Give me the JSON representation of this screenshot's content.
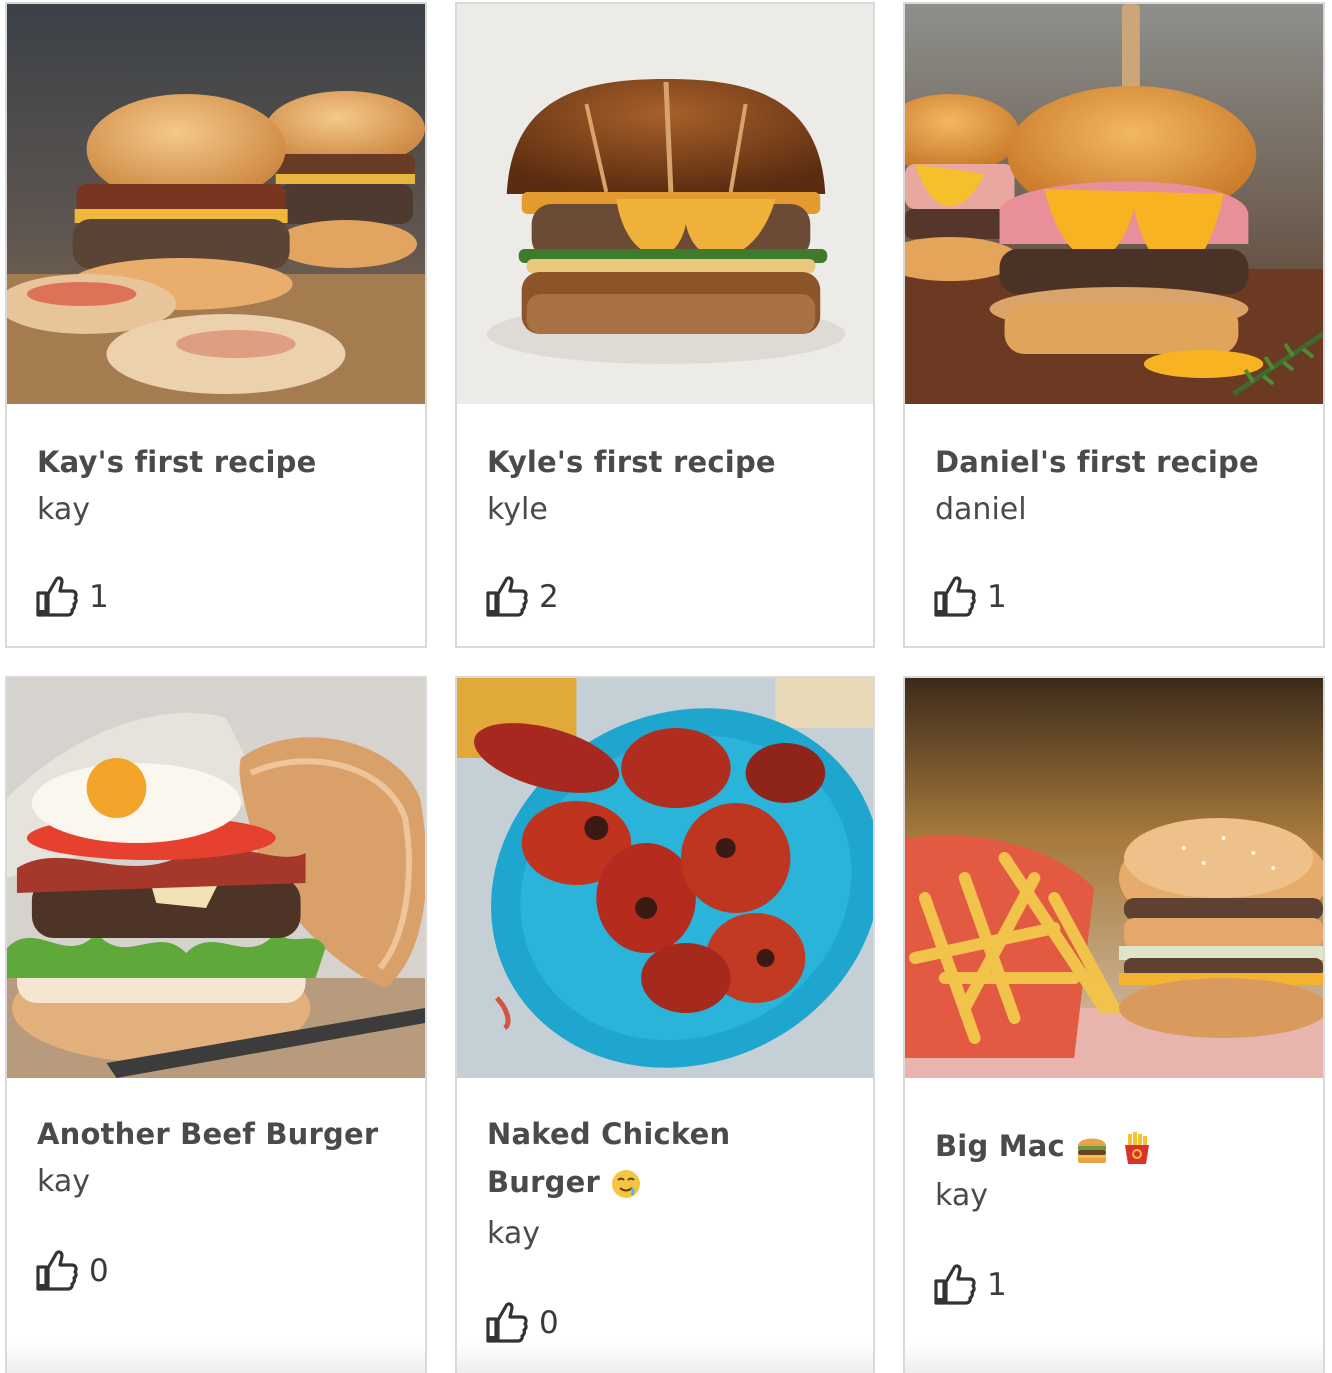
{
  "cards": [
    {
      "title": "Kay's first recipe",
      "author": "kay",
      "likes": "1",
      "image": "burger-sliders-photo"
    },
    {
      "title": "Kyle's first recipe",
      "author": "kyle",
      "likes": "2",
      "image": "pretzel-burger-photo"
    },
    {
      "title": "Daniel's first recipe",
      "author": "daniel",
      "likes": "1",
      "image": "ham-cheese-burger-photo"
    },
    {
      "title": "Another Beef Burger",
      "author": "kay",
      "likes": "0",
      "image": "egg-bacon-burger-photo"
    },
    {
      "title_line1": "Naked Chicken",
      "title_line2": "Burger",
      "title_emoji": "drooling-face-emoji",
      "author": "kay",
      "likes": "0",
      "image": "chicken-drumsticks-photo"
    },
    {
      "title": "Big Mac",
      "title_emojis": [
        "hamburger-emoji",
        "fries-emoji"
      ],
      "author": "kay",
      "likes": "1",
      "image": "big-mac-fries-photo"
    }
  ],
  "colors": {
    "card_border": "#d9d9d9",
    "text": "#4a4a4a",
    "background": "#ffffff"
  },
  "icons": {
    "like": "thumbs-up-icon"
  }
}
